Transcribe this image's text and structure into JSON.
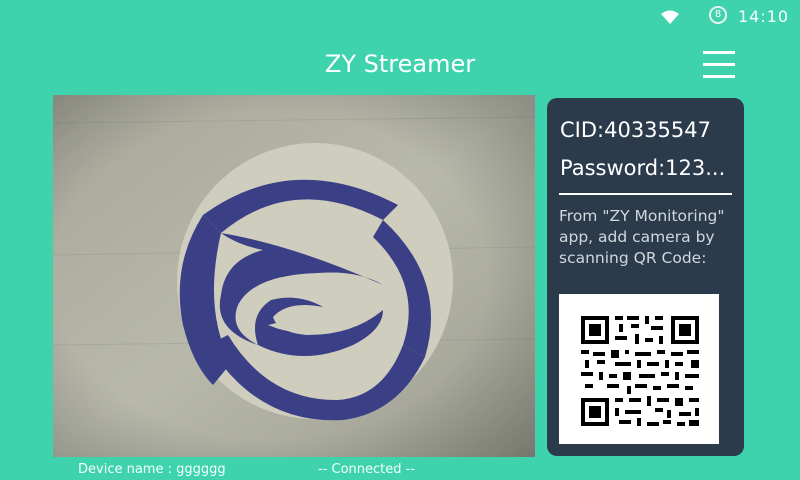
{
  "status_bar": {
    "wifi_icon": "wifi-icon",
    "notification_count": "8",
    "time": "14:10"
  },
  "app_bar": {
    "title": "ZY Streamer",
    "menu_icon": "hamburger-menu-icon"
  },
  "camera_preview": {
    "content": "live-camera-feed"
  },
  "side_panel": {
    "cid": "CID:40335547",
    "password": "Password:123...",
    "instructions": "From \"ZY Monitoring\" app, add camera by scanning QR Code:",
    "qr_icon": "qr-code-icon"
  },
  "footer": {
    "device_name": "Device name : gggggg",
    "status": "-- Connected --"
  },
  "colors": {
    "background": "#3fd3ad",
    "panel": "#2b3b4c",
    "logo": "#3b3f86"
  }
}
